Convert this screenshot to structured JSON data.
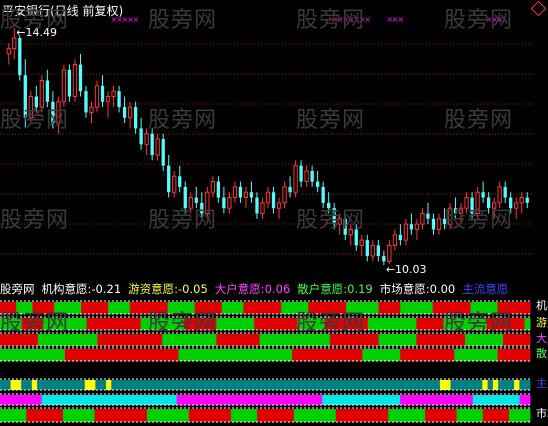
{
  "chart_title": "平安银行(日线 前复权)",
  "price_labels": {
    "high": "14.49",
    "low": "10.03"
  },
  "watermark": "股旁网",
  "indicators": {
    "prefix": "股旁网",
    "jigou": {
      "label": "机构意愿:",
      "value": "-0.21"
    },
    "youzi": {
      "label": "游资意愿:",
      "value": "-0.05"
    },
    "dahu": {
      "label": "大户意愿:",
      "value": "0.06"
    },
    "sanhu": {
      "label": "散户意愿:",
      "value": "0.19"
    },
    "shichang": {
      "label": "市场意愿:",
      "value": "0.00"
    },
    "zhuli": "主流意愿"
  },
  "right_labels": [
    "机构",
    "游资",
    "大户",
    "散户",
    "主流",
    "市场"
  ],
  "colors": {
    "up": "#ff3232",
    "down": "#54fcfc",
    "grid": "#a01010",
    "green": "#00d000",
    "red": "#e00000",
    "cyan": "#00e8e8",
    "magenta": "#ff00ff",
    "yellow": "#ffff00",
    "teal": "#008080"
  },
  "chart_data": {
    "type": "candlestick",
    "title": "平安银行(日线 前复权)",
    "annotations": [
      "14.49",
      "10.03"
    ],
    "ylim": [
      9.9,
      14.6
    ],
    "candles": [
      [
        14.0,
        14.2,
        13.8,
        14.1
      ],
      [
        14.1,
        14.49,
        13.9,
        14.3
      ],
      [
        14.3,
        14.35,
        13.5,
        13.6
      ],
      [
        13.6,
        13.9,
        12.6,
        12.8
      ],
      [
        12.8,
        13.3,
        12.7,
        13.2
      ],
      [
        13.2,
        13.4,
        12.9,
        13.0
      ],
      [
        13.0,
        13.6,
        12.9,
        13.5
      ],
      [
        13.5,
        13.7,
        13.0,
        13.1
      ],
      [
        13.1,
        13.3,
        12.6,
        12.7
      ],
      [
        12.7,
        13.2,
        12.5,
        13.1
      ],
      [
        13.1,
        13.8,
        13.0,
        13.7
      ],
      [
        13.7,
        13.8,
        13.1,
        13.2
      ],
      [
        13.2,
        13.9,
        13.1,
        13.8
      ],
      [
        13.8,
        14.0,
        13.2,
        13.3
      ],
      [
        13.3,
        13.4,
        12.8,
        12.9
      ],
      [
        12.9,
        13.1,
        12.7,
        13.0
      ],
      [
        13.0,
        13.5,
        12.9,
        13.4
      ],
      [
        13.4,
        13.6,
        13.0,
        13.1
      ],
      [
        13.1,
        13.3,
        12.8,
        13.2
      ],
      [
        13.2,
        13.4,
        13.0,
        13.3
      ],
      [
        13.3,
        13.4,
        12.9,
        13.0
      ],
      [
        13.0,
        13.2,
        12.7,
        12.8
      ],
      [
        12.8,
        13.1,
        12.6,
        13.0
      ],
      [
        13.0,
        13.1,
        12.5,
        12.6
      ],
      [
        12.6,
        12.8,
        12.2,
        12.3
      ],
      [
        12.3,
        12.6,
        12.1,
        12.5
      ],
      [
        12.5,
        12.6,
        12.0,
        12.1
      ],
      [
        12.1,
        12.5,
        12.0,
        12.4
      ],
      [
        12.4,
        12.5,
        11.8,
        11.9
      ],
      [
        11.9,
        12.1,
        11.3,
        11.4
      ],
      [
        11.4,
        11.8,
        11.3,
        11.7
      ],
      [
        11.7,
        11.9,
        11.4,
        11.5
      ],
      [
        11.5,
        11.6,
        11.0,
        11.1
      ],
      [
        11.1,
        11.4,
        11.0,
        11.3
      ],
      [
        11.3,
        11.5,
        11.1,
        11.2
      ],
      [
        11.2,
        11.4,
        10.9,
        11.0
      ],
      [
        11.0,
        11.5,
        10.9,
        11.4
      ],
      [
        11.4,
        11.7,
        11.3,
        11.6
      ],
      [
        11.6,
        11.7,
        11.2,
        11.3
      ],
      [
        11.3,
        11.5,
        11.0,
        11.1
      ],
      [
        11.1,
        11.4,
        11.0,
        11.3
      ],
      [
        11.3,
        11.6,
        11.2,
        11.5
      ],
      [
        11.5,
        11.6,
        11.2,
        11.3
      ],
      [
        11.3,
        11.5,
        11.1,
        11.4
      ],
      [
        11.4,
        11.6,
        11.2,
        11.3
      ],
      [
        11.3,
        11.4,
        10.9,
        11.0
      ],
      [
        11.0,
        11.3,
        10.9,
        11.2
      ],
      [
        11.2,
        11.5,
        11.1,
        11.4
      ],
      [
        11.4,
        11.5,
        11.0,
        11.1
      ],
      [
        11.1,
        11.3,
        10.9,
        11.2
      ],
      [
        11.2,
        11.6,
        11.1,
        11.5
      ],
      [
        11.5,
        11.7,
        11.3,
        11.4
      ],
      [
        11.4,
        12.0,
        11.3,
        11.9
      ],
      [
        11.9,
        12.0,
        11.5,
        11.6
      ],
      [
        11.6,
        11.9,
        11.5,
        11.8
      ],
      [
        11.8,
        11.9,
        11.5,
        11.6
      ],
      [
        11.6,
        11.8,
        11.4,
        11.5
      ],
      [
        11.5,
        11.6,
        11.1,
        11.2
      ],
      [
        11.2,
        11.4,
        11.0,
        11.1
      ],
      [
        11.1,
        11.2,
        10.7,
        10.8
      ],
      [
        10.8,
        11.0,
        10.6,
        10.9
      ],
      [
        10.9,
        11.0,
        10.5,
        10.6
      ],
      [
        10.6,
        10.8,
        10.4,
        10.7
      ],
      [
        10.7,
        10.8,
        10.3,
        10.4
      ],
      [
        10.4,
        10.6,
        10.2,
        10.5
      ],
      [
        10.5,
        10.6,
        10.1,
        10.2
      ],
      [
        10.2,
        10.5,
        10.1,
        10.4
      ],
      [
        10.4,
        10.5,
        10.1,
        10.2
      ],
      [
        10.2,
        10.3,
        10.03,
        10.1
      ],
      [
        10.1,
        10.5,
        10.05,
        10.4
      ],
      [
        10.4,
        10.7,
        10.3,
        10.6
      ],
      [
        10.6,
        10.8,
        10.4,
        10.5
      ],
      [
        10.5,
        10.9,
        10.4,
        10.8
      ],
      [
        10.8,
        11.0,
        10.6,
        10.7
      ],
      [
        10.7,
        10.9,
        10.5,
        10.8
      ],
      [
        10.8,
        11.1,
        10.7,
        11.0
      ],
      [
        11.0,
        11.2,
        10.8,
        10.9
      ],
      [
        10.9,
        11.0,
        10.6,
        10.7
      ],
      [
        10.7,
        11.0,
        10.6,
        10.9
      ],
      [
        10.9,
        11.1,
        10.7,
        10.8
      ],
      [
        10.8,
        11.2,
        10.7,
        11.1
      ],
      [
        11.1,
        11.3,
        10.9,
        11.0
      ],
      [
        11.0,
        11.2,
        10.8,
        11.1
      ],
      [
        11.1,
        11.4,
        11.0,
        11.3
      ],
      [
        11.3,
        11.4,
        10.9,
        11.0
      ],
      [
        11.0,
        11.5,
        10.9,
        11.4
      ],
      [
        11.4,
        11.6,
        11.2,
        11.3
      ],
      [
        11.3,
        11.4,
        11.0,
        11.1
      ],
      [
        11.1,
        11.3,
        10.9,
        11.2
      ],
      [
        11.2,
        11.6,
        11.1,
        11.5
      ],
      [
        11.5,
        11.6,
        11.2,
        11.3
      ],
      [
        11.3,
        11.4,
        11.0,
        11.1
      ],
      [
        11.1,
        11.3,
        10.9,
        11.2
      ],
      [
        11.2,
        11.4,
        11.0,
        11.3
      ],
      [
        11.3,
        11.4,
        11.1,
        11.2
      ]
    ]
  },
  "strips": {
    "jigou": "RRRGGGRRRRGGGGGRRRRRGGGGRRRRRRRGGGGGRRRRRGGGGRRRRRRRGGGGGRRRRRRRGGGGGGRRRRGGGGGGRRRRRRRGGGGGRRRRRR",
    "youzi": "GGGGRRRRGGGGGGGGRRRRRRRRRRGGGGGGGGRRRRRRGGGGGGGRRRRRRRRGGGGGRRRRRRRRGGGGGGGGGRRRRRGGGGGGGGRRRRRRRG",
    "dahu": "RRRRRRRGGGGGGGGGGGRRRRRRRRRRRRGGGGGGGGGGRRRRRRRRGGGGGGGGGGGGGRRRRRRRRRGGGGGGGRRRRRRRRRGGGGGGGRRRRR",
    "sanhu": "GGGGGGGGGGGGRRRRRRRRRRRRRRRRRRRRRGGGGGGGGGGGGGGGGGGGGGRRRRRRRRRRRRRGGGGGGGRRRRRRRRRRGGGGGGGGRRRRRR",
    "zhuli": "TTYYTTYTTTTTTTTTYYTTYTTTTTTTTTTTTTTTTTTTTTTTTTTTTTTTTTTTTTTTTTTTTTTTTTTTTTTTTTTTTTTYYTTTTTTYTYTTTYTT",
    "color1": "MMMMMMMMCCCCCCCCCCCCCCCCCCCCCCCCCCMMMMMMMMMMMMMMMMMMMMMMMMMMMMCCCCCCCCCCCCCCCMMMMMMMMMMMMMMCCCCCCCCCMM",
    "color2": "GGGGGRRRRRRRGGGGGGRRRRRRRRRRGGGGGGGGRRRRRRRRGGGGGRRRRRRRGGGGGGGGRRRRRRRRRRGGGGGGGRRRRRRGGGGGRRRRRGGGG"
  }
}
